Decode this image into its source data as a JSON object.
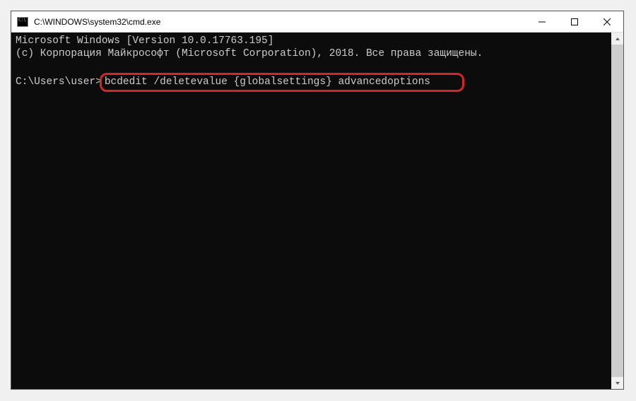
{
  "titlebar": {
    "title": "C:\\WINDOWS\\system32\\cmd.exe"
  },
  "terminal": {
    "line1": "Microsoft Windows [Version 10.0.17763.195]",
    "line2": "(c) Корпорация Майкрософт (Microsoft Corporation), 2018. Все права защищены.",
    "prompt": "C:\\Users\\user>",
    "command": "bcdedit /deletevalue {globalsettings} advancedoptions"
  }
}
